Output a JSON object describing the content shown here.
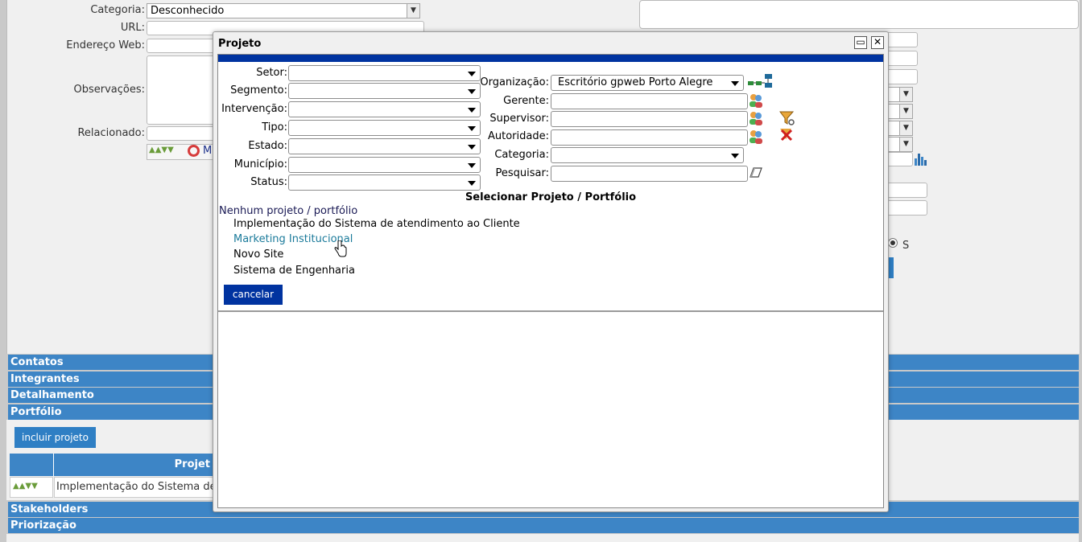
{
  "background": {
    "form_labels": {
      "categoria": "Categoria:",
      "url": "URL:",
      "endereco_web": "Endereço Web:",
      "observacoes": "Observações:",
      "relacionado": "Relacionado:"
    },
    "categoria_value": "Desconhecido",
    "truncated_link": "M",
    "radio_label": "S",
    "sections": [
      "Contatos",
      "Integrantes",
      "Detalhamento",
      "Portfólio",
      "Stakeholders",
      "Priorização"
    ],
    "incluir_projeto": "incluir projeto",
    "table": {
      "header": "Projet",
      "row_text": "Implementação do Sistema de"
    }
  },
  "modal": {
    "title": "Projeto",
    "filters_left": [
      {
        "label": "Setor:",
        "value": ""
      },
      {
        "label": "Segmento:",
        "value": ""
      },
      {
        "label": "Intervenção:",
        "value": ""
      },
      {
        "label": "Tipo:",
        "value": ""
      },
      {
        "label": "Estado:",
        "value": ""
      },
      {
        "label": "Município:",
        "value": ""
      },
      {
        "label": "Status:",
        "value": ""
      }
    ],
    "organizacao": {
      "label": "Organização:",
      "value": "Escritório gpweb Porto Alegre"
    },
    "gerente": {
      "label": "Gerente:",
      "value": ""
    },
    "supervisor": {
      "label": "Supervisor:",
      "value": ""
    },
    "autoridade": {
      "label": "Autoridade:",
      "value": ""
    },
    "categoria": {
      "label": "Categoria:",
      "value": ""
    },
    "pesquisar": {
      "label": "Pesquisar:",
      "value": ""
    },
    "section_title": "Selecionar Projeto / Portfólio",
    "none_option": "Nenhum projeto / portfólio",
    "projects": [
      "Implementação do Sistema de atendimento ao Cliente",
      "Marketing Institucional",
      "Novo Site",
      "Sistema de Engenharia"
    ],
    "cancel_label": "cancelar",
    "colors": {
      "hover_link": "#1a7a9a",
      "header_bar": "#0033a0",
      "button": "#0033a0"
    },
    "icons": [
      "organization-chart-icon",
      "users-icon",
      "filter-icon",
      "remove-filter-icon",
      "eraser-icon",
      "maximize-icon",
      "close-icon"
    ]
  }
}
